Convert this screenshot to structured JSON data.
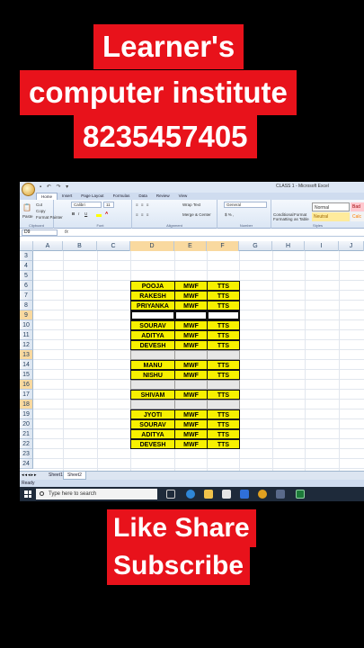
{
  "banner_top": {
    "line1": "Learner's",
    "line2": "computer institute",
    "line3": "8235457405"
  },
  "banner_bottom": {
    "line1": "Like Share",
    "line2": "Subscribe"
  },
  "window": {
    "title": "CLASS 1 - Microsoft Excel",
    "qat": "▪ ↶ ↷ ▾"
  },
  "ribbon_tabs": [
    "Home",
    "Insert",
    "Page Layout",
    "Formulas",
    "Data",
    "Review",
    "View"
  ],
  "ribbon": {
    "clipboard": {
      "paste": "Paste",
      "cut": "Cut",
      "copy": "Copy",
      "format_painter": "Format Painter",
      "group": "Clipboard"
    },
    "font": {
      "name": "Calibri",
      "size": "11",
      "group": "Font",
      "bold": "B",
      "italic": "I",
      "underline": "U"
    },
    "alignment": {
      "wrap": "Wrap Text",
      "merge": "Merge & Center",
      "group": "Alignment"
    },
    "number": {
      "format": "General",
      "group": "Number"
    },
    "styles": {
      "conditional": "Conditional Formatting",
      "format_as_table": "Format as Table",
      "normal": "Normal",
      "bad": "Bad",
      "neutral": "Neutral",
      "calc": "Calc",
      "group": "Styles"
    }
  },
  "formula_bar": {
    "name_box": "D9",
    "fx": "fx"
  },
  "columns": [
    "A",
    "B",
    "C",
    "D",
    "E",
    "F",
    "G",
    "H",
    "I",
    "J"
  ],
  "rows": [
    "3",
    "4",
    "5",
    "6",
    "7",
    "8",
    "9",
    "10",
    "11",
    "12",
    "13",
    "14",
    "15",
    "16",
    "17",
    "18",
    "19",
    "20",
    "21",
    "22",
    "23",
    "24"
  ],
  "table": [
    {
      "row": "6",
      "name": "POOJA",
      "days": "MWF",
      "course": "TTS"
    },
    {
      "row": "7",
      "name": "RAKESH",
      "days": "MWF",
      "course": "TTS"
    },
    {
      "row": "8",
      "name": "PRIYANKA",
      "days": "MWF",
      "course": "TTS"
    },
    {
      "row": "9",
      "name": "",
      "days": "",
      "course": ""
    },
    {
      "row": "10",
      "name": "SOURAV",
      "days": "MWF",
      "course": "TTS"
    },
    {
      "row": "11",
      "name": "ADITYA",
      "days": "MWF",
      "course": "TTS"
    },
    {
      "row": "12",
      "name": "DEVESH",
      "days": "MWF",
      "course": "TTS"
    },
    {
      "row": "13",
      "name": "",
      "days": "",
      "course": ""
    },
    {
      "row": "14",
      "name": "MANU",
      "days": "MWF",
      "course": "TTS"
    },
    {
      "row": "15",
      "name": "NISHU",
      "days": "MWF",
      "course": "TTS"
    },
    {
      "row": "16",
      "name": "",
      "days": "",
      "course": ""
    },
    {
      "row": "17",
      "name": "SHIVAM",
      "days": "MWF",
      "course": "TTS"
    },
    {
      "row": "18",
      "name": "",
      "days": "",
      "course": ""
    },
    {
      "row": "19",
      "name": "JYOTI",
      "days": "MWF",
      "course": "TTS"
    },
    {
      "row": "20",
      "name": "SOURAV",
      "days": "MWF",
      "course": "TTS"
    },
    {
      "row": "21",
      "name": "ADITYA",
      "days": "MWF",
      "course": "TTS"
    },
    {
      "row": "22",
      "name": "DEVESH",
      "days": "MWF",
      "course": "TTS"
    }
  ],
  "sheets": [
    "Sheet1",
    "Sheet2"
  ],
  "status": "Ready",
  "taskbar": {
    "search_placeholder": "Type here to search"
  },
  "colors": {
    "banner_red": "#e8121b",
    "cell_yellow": "#f7f000"
  }
}
